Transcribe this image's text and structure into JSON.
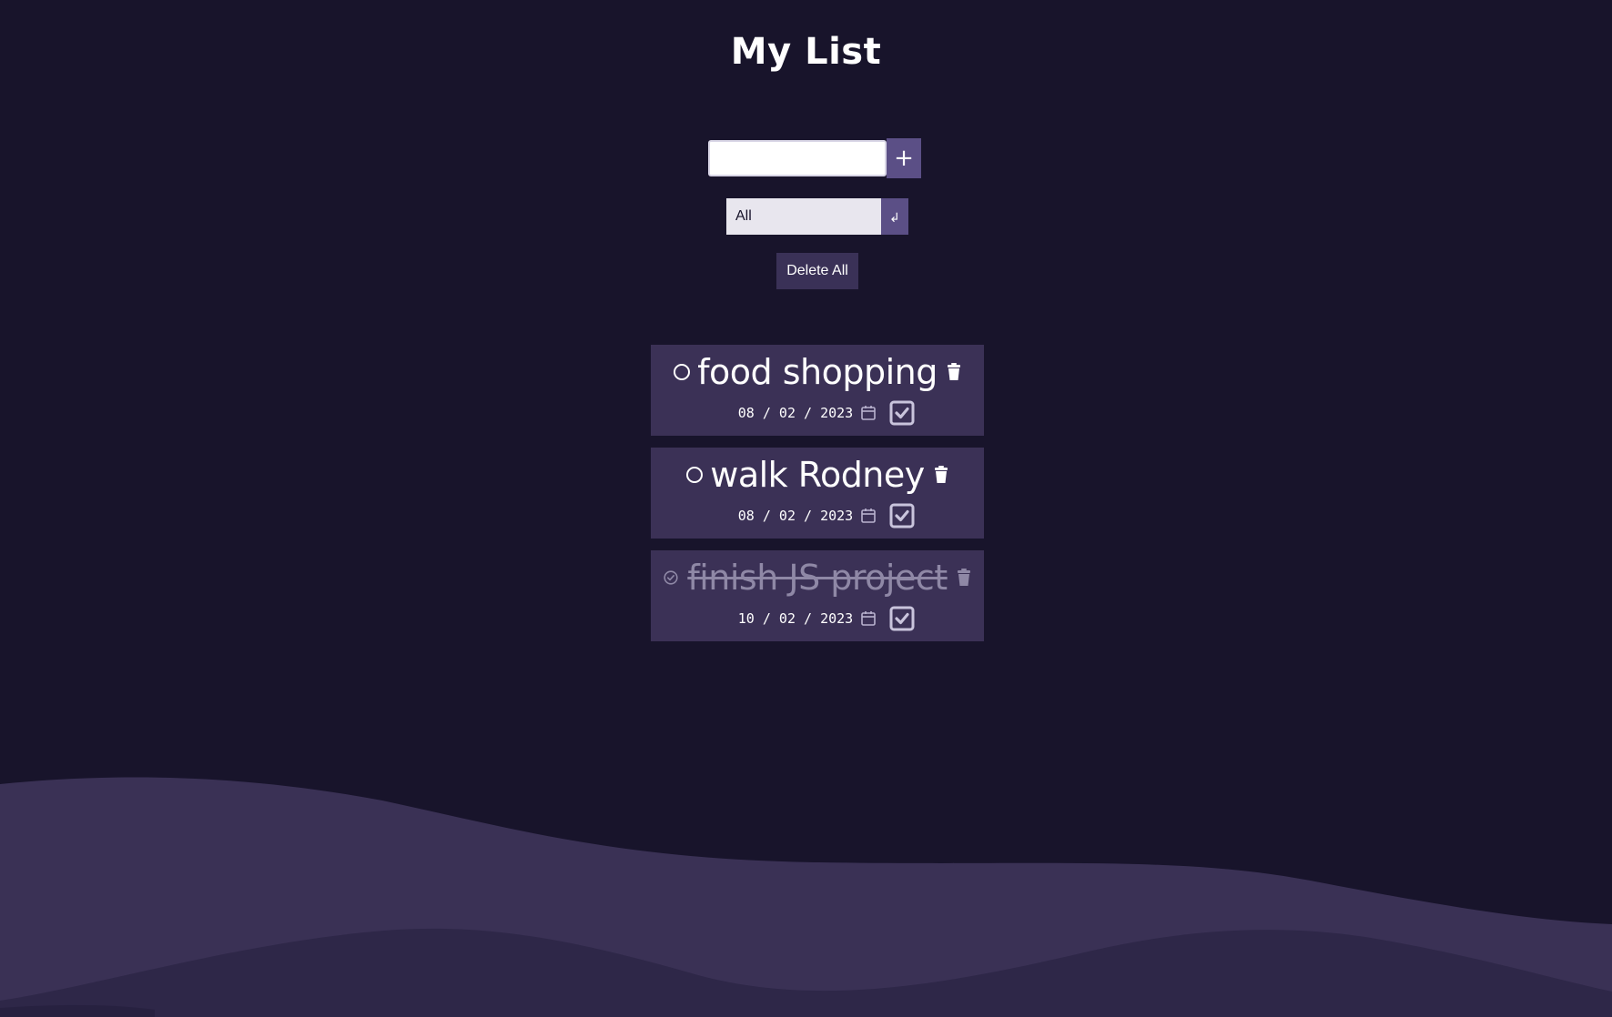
{
  "app": {
    "title": "My List"
  },
  "add_form": {
    "input_value": "",
    "add_button_label": "+"
  },
  "filter": {
    "selected": "All",
    "submit_label": "↲"
  },
  "delete_all_label": "Delete All",
  "todos": [
    {
      "text": "food shopping",
      "date": "08 / 02 / 2023",
      "completed": false
    },
    {
      "text": "walk Rodney",
      "date": "08 / 02 / 2023",
      "completed": false
    },
    {
      "text": "finish JS project",
      "date": "10 / 02 / 2023",
      "completed": true
    }
  ],
  "colors": {
    "background": "#18142b",
    "card": "#3b3156",
    "accent": "#5b4f86",
    "wave_front": "#3a3155",
    "wave_back": "#2d2647"
  }
}
